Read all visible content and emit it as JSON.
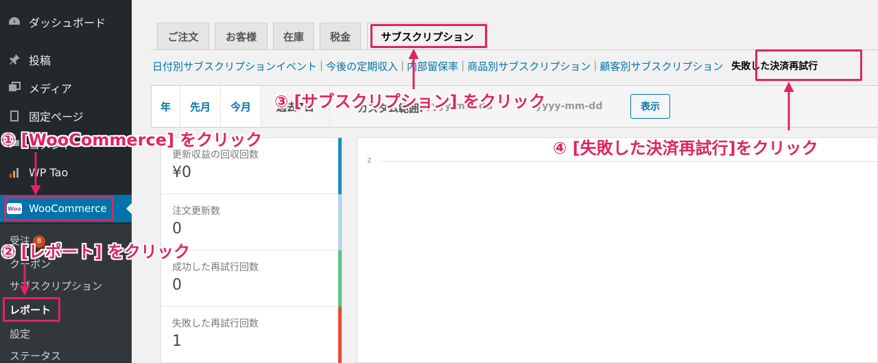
{
  "sidebar": {
    "items": [
      {
        "label": "ダッシュボード",
        "icon": "dashboard-icon"
      },
      {
        "label": "投稿",
        "icon": "pin-icon"
      },
      {
        "label": "メディア",
        "icon": "media-icon"
      },
      {
        "label": "固定ページ",
        "icon": "page-icon"
      },
      {
        "label": "コメント",
        "icon": "comment-icon"
      },
      {
        "label": "WP Tao",
        "icon": "chart-icon"
      },
      {
        "label": "WooCommerce",
        "icon": "woo-icon"
      }
    ],
    "woo_logo_text": "Woo",
    "submenu": [
      {
        "label": "受注",
        "badge": "8"
      },
      {
        "label": "クーポン"
      },
      {
        "label": "サブスクリプション"
      },
      {
        "label": "レポート"
      },
      {
        "label": "設定"
      },
      {
        "label": "ステータス"
      }
    ]
  },
  "tabs": [
    "ご注文",
    "お客様",
    "在庫",
    "税金",
    "サブスクリプション"
  ],
  "subnav": {
    "links": [
      "日付別サブスクリプションイベント",
      "今後の定期収入",
      "内部留保率",
      "商品別サブスクリプション",
      "顧客別サブスクリプション"
    ],
    "current": "失敗した決済再試行"
  },
  "range": {
    "buttons": [
      "年",
      "先月",
      "今月",
      "過去7日"
    ],
    "custom_label": "カスタム範囲:",
    "date_placeholder": "yyyy-mm-dd",
    "show_label": "表示"
  },
  "stats": [
    {
      "title": "更新収益の回収回数",
      "value": "¥0",
      "color": "#1e8cbe"
    },
    {
      "title": "注文更新数",
      "value": "0",
      "color": "#b1d4ea"
    },
    {
      "title": "成功した再試行回数",
      "value": "0",
      "color": "#5cc488"
    },
    {
      "title": "失敗した再試行回数",
      "value": "1",
      "color": "#e74c3c"
    }
  ],
  "chart": {
    "tick": "2"
  },
  "annotations": {
    "step1": "① [WooCommerce] をクリック",
    "step2": "② [レポート] をクリック",
    "step3": "③ [サブスクリプション] をクリック",
    "step4": "④ [失敗した決済再試行]をクリック",
    "color": "#e0245e"
  }
}
